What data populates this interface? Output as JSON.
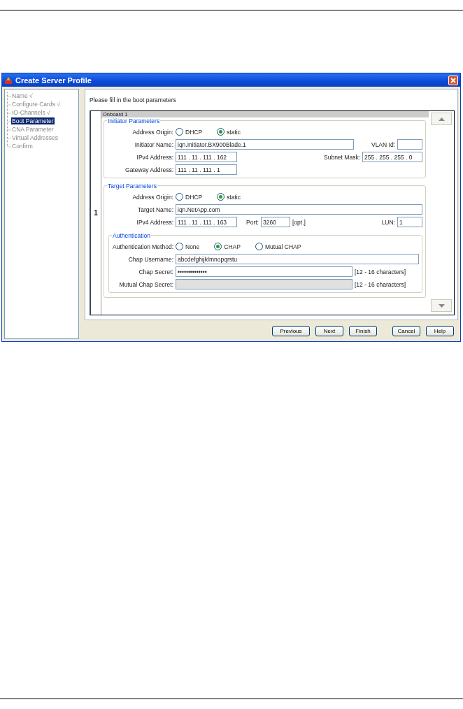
{
  "window": {
    "title": "Create Server Profile"
  },
  "steps": [
    {
      "label": "Name √",
      "selected": false
    },
    {
      "label": "Configure Cards √",
      "selected": false
    },
    {
      "label": "IO-Channels √",
      "selected": false
    },
    {
      "label": "Boot Parameter",
      "selected": true
    },
    {
      "label": "CNA Parameter",
      "selected": false
    },
    {
      "label": "Virtual Addresses",
      "selected": false
    },
    {
      "label": "Confirm",
      "selected": false
    }
  ],
  "instruction": "Please fill in the boot parameters",
  "panel_header": "Onboard 1",
  "row_number": "1",
  "initiator": {
    "title": "Initiator Parameters",
    "origin_label": "Address Origin:",
    "origin_options": [
      {
        "label": "DHCP",
        "selected": false
      },
      {
        "label": "static",
        "selected": true
      }
    ],
    "name_label": "Initiator Name:",
    "name_value": "iqn.Initiator.BX900Blade.1",
    "vlan_label": "VLAN Id:",
    "ipv4_label": "IPv4 Address:",
    "ipv4_value": "111 . 11 . 111 . 162",
    "mask_label": "Subnet Mask:",
    "mask_value": "255 . 255 . 255 .  0",
    "gateway_label": "Gateway Address:",
    "gateway_value": "111 . 11 . 111 .  1"
  },
  "target": {
    "title": "Target Parameters",
    "origin_label": "Address Origin:",
    "origin_options": [
      {
        "label": "DHCP",
        "selected": false
      },
      {
        "label": "static",
        "selected": true
      }
    ],
    "name_label": "Target Name:",
    "name_value": "iqn.NetApp.com",
    "ipv4_label": "IPv4 Address:",
    "ipv4_value": "111 . 11 . 111 . 163",
    "port_label": "Port:",
    "port_value": "3260",
    "port_hint": "[opt.]",
    "lun_label": "LUN:",
    "lun_value": "1"
  },
  "authentication": {
    "title": "Authentication",
    "method_label": "Authentication Method:",
    "method_options": [
      {
        "label": "None",
        "selected": false
      },
      {
        "label": "CHAP",
        "selected": true
      },
      {
        "label": "Mutual CHAP",
        "selected": false
      }
    ],
    "fields": [
      {
        "label": "Chap Username:",
        "value": "abcdefghijklmnopqrstu",
        "disabled": false
      },
      {
        "label": "Chap Secret:",
        "value": "••••••••••••••",
        "hint": "[12 - 16 characters]",
        "disabled": false
      },
      {
        "label": "Mutual Chap Secret:",
        "hint": "[12 - 16 characters]",
        "disabled": true
      }
    ]
  },
  "buttons": [
    "Previous",
    "Next",
    "Finish",
    "Cancel",
    "Help"
  ]
}
